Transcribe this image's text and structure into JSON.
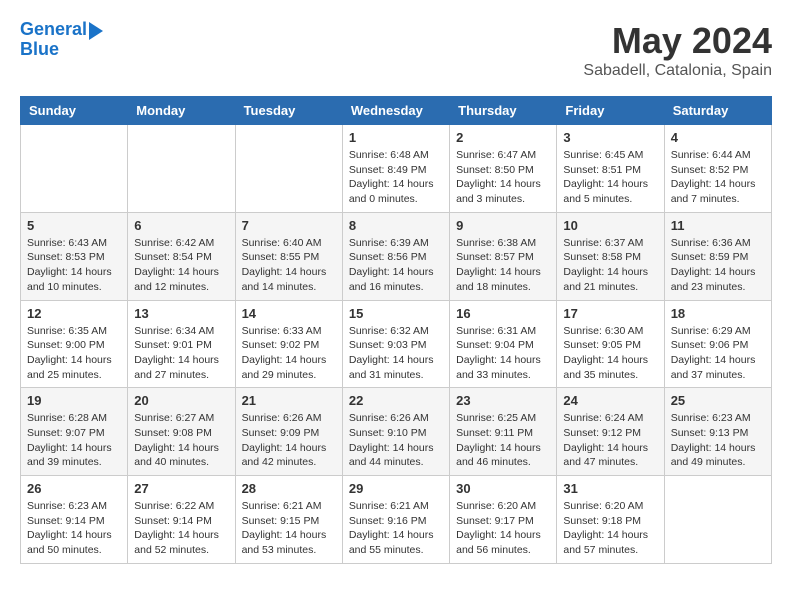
{
  "logo": {
    "line1": "General",
    "line2": "Blue"
  },
  "header": {
    "month": "May 2024",
    "location": "Sabadell, Catalonia, Spain"
  },
  "days_of_week": [
    "Sunday",
    "Monday",
    "Tuesday",
    "Wednesday",
    "Thursday",
    "Friday",
    "Saturday"
  ],
  "weeks": [
    [
      {
        "day": "",
        "info": ""
      },
      {
        "day": "",
        "info": ""
      },
      {
        "day": "",
        "info": ""
      },
      {
        "day": "1",
        "sunrise": "Sunrise: 6:48 AM",
        "sunset": "Sunset: 8:49 PM",
        "daylight": "Daylight: 14 hours and 0 minutes."
      },
      {
        "day": "2",
        "sunrise": "Sunrise: 6:47 AM",
        "sunset": "Sunset: 8:50 PM",
        "daylight": "Daylight: 14 hours and 3 minutes."
      },
      {
        "day": "3",
        "sunrise": "Sunrise: 6:45 AM",
        "sunset": "Sunset: 8:51 PM",
        "daylight": "Daylight: 14 hours and 5 minutes."
      },
      {
        "day": "4",
        "sunrise": "Sunrise: 6:44 AM",
        "sunset": "Sunset: 8:52 PM",
        "daylight": "Daylight: 14 hours and 7 minutes."
      }
    ],
    [
      {
        "day": "5",
        "sunrise": "Sunrise: 6:43 AM",
        "sunset": "Sunset: 8:53 PM",
        "daylight": "Daylight: 14 hours and 10 minutes."
      },
      {
        "day": "6",
        "sunrise": "Sunrise: 6:42 AM",
        "sunset": "Sunset: 8:54 PM",
        "daylight": "Daylight: 14 hours and 12 minutes."
      },
      {
        "day": "7",
        "sunrise": "Sunrise: 6:40 AM",
        "sunset": "Sunset: 8:55 PM",
        "daylight": "Daylight: 14 hours and 14 minutes."
      },
      {
        "day": "8",
        "sunrise": "Sunrise: 6:39 AM",
        "sunset": "Sunset: 8:56 PM",
        "daylight": "Daylight: 14 hours and 16 minutes."
      },
      {
        "day": "9",
        "sunrise": "Sunrise: 6:38 AM",
        "sunset": "Sunset: 8:57 PM",
        "daylight": "Daylight: 14 hours and 18 minutes."
      },
      {
        "day": "10",
        "sunrise": "Sunrise: 6:37 AM",
        "sunset": "Sunset: 8:58 PM",
        "daylight": "Daylight: 14 hours and 21 minutes."
      },
      {
        "day": "11",
        "sunrise": "Sunrise: 6:36 AM",
        "sunset": "Sunset: 8:59 PM",
        "daylight": "Daylight: 14 hours and 23 minutes."
      }
    ],
    [
      {
        "day": "12",
        "sunrise": "Sunrise: 6:35 AM",
        "sunset": "Sunset: 9:00 PM",
        "daylight": "Daylight: 14 hours and 25 minutes."
      },
      {
        "day": "13",
        "sunrise": "Sunrise: 6:34 AM",
        "sunset": "Sunset: 9:01 PM",
        "daylight": "Daylight: 14 hours and 27 minutes."
      },
      {
        "day": "14",
        "sunrise": "Sunrise: 6:33 AM",
        "sunset": "Sunset: 9:02 PM",
        "daylight": "Daylight: 14 hours and 29 minutes."
      },
      {
        "day": "15",
        "sunrise": "Sunrise: 6:32 AM",
        "sunset": "Sunset: 9:03 PM",
        "daylight": "Daylight: 14 hours and 31 minutes."
      },
      {
        "day": "16",
        "sunrise": "Sunrise: 6:31 AM",
        "sunset": "Sunset: 9:04 PM",
        "daylight": "Daylight: 14 hours and 33 minutes."
      },
      {
        "day": "17",
        "sunrise": "Sunrise: 6:30 AM",
        "sunset": "Sunset: 9:05 PM",
        "daylight": "Daylight: 14 hours and 35 minutes."
      },
      {
        "day": "18",
        "sunrise": "Sunrise: 6:29 AM",
        "sunset": "Sunset: 9:06 PM",
        "daylight": "Daylight: 14 hours and 37 minutes."
      }
    ],
    [
      {
        "day": "19",
        "sunrise": "Sunrise: 6:28 AM",
        "sunset": "Sunset: 9:07 PM",
        "daylight": "Daylight: 14 hours and 39 minutes."
      },
      {
        "day": "20",
        "sunrise": "Sunrise: 6:27 AM",
        "sunset": "Sunset: 9:08 PM",
        "daylight": "Daylight: 14 hours and 40 minutes."
      },
      {
        "day": "21",
        "sunrise": "Sunrise: 6:26 AM",
        "sunset": "Sunset: 9:09 PM",
        "daylight": "Daylight: 14 hours and 42 minutes."
      },
      {
        "day": "22",
        "sunrise": "Sunrise: 6:26 AM",
        "sunset": "Sunset: 9:10 PM",
        "daylight": "Daylight: 14 hours and 44 minutes."
      },
      {
        "day": "23",
        "sunrise": "Sunrise: 6:25 AM",
        "sunset": "Sunset: 9:11 PM",
        "daylight": "Daylight: 14 hours and 46 minutes."
      },
      {
        "day": "24",
        "sunrise": "Sunrise: 6:24 AM",
        "sunset": "Sunset: 9:12 PM",
        "daylight": "Daylight: 14 hours and 47 minutes."
      },
      {
        "day": "25",
        "sunrise": "Sunrise: 6:23 AM",
        "sunset": "Sunset: 9:13 PM",
        "daylight": "Daylight: 14 hours and 49 minutes."
      }
    ],
    [
      {
        "day": "26",
        "sunrise": "Sunrise: 6:23 AM",
        "sunset": "Sunset: 9:14 PM",
        "daylight": "Daylight: 14 hours and 50 minutes."
      },
      {
        "day": "27",
        "sunrise": "Sunrise: 6:22 AM",
        "sunset": "Sunset: 9:14 PM",
        "daylight": "Daylight: 14 hours and 52 minutes."
      },
      {
        "day": "28",
        "sunrise": "Sunrise: 6:21 AM",
        "sunset": "Sunset: 9:15 PM",
        "daylight": "Daylight: 14 hours and 53 minutes."
      },
      {
        "day": "29",
        "sunrise": "Sunrise: 6:21 AM",
        "sunset": "Sunset: 9:16 PM",
        "daylight": "Daylight: 14 hours and 55 minutes."
      },
      {
        "day": "30",
        "sunrise": "Sunrise: 6:20 AM",
        "sunset": "Sunset: 9:17 PM",
        "daylight": "Daylight: 14 hours and 56 minutes."
      },
      {
        "day": "31",
        "sunrise": "Sunrise: 6:20 AM",
        "sunset": "Sunset: 9:18 PM",
        "daylight": "Daylight: 14 hours and 57 minutes."
      },
      {
        "day": "",
        "info": ""
      }
    ]
  ]
}
